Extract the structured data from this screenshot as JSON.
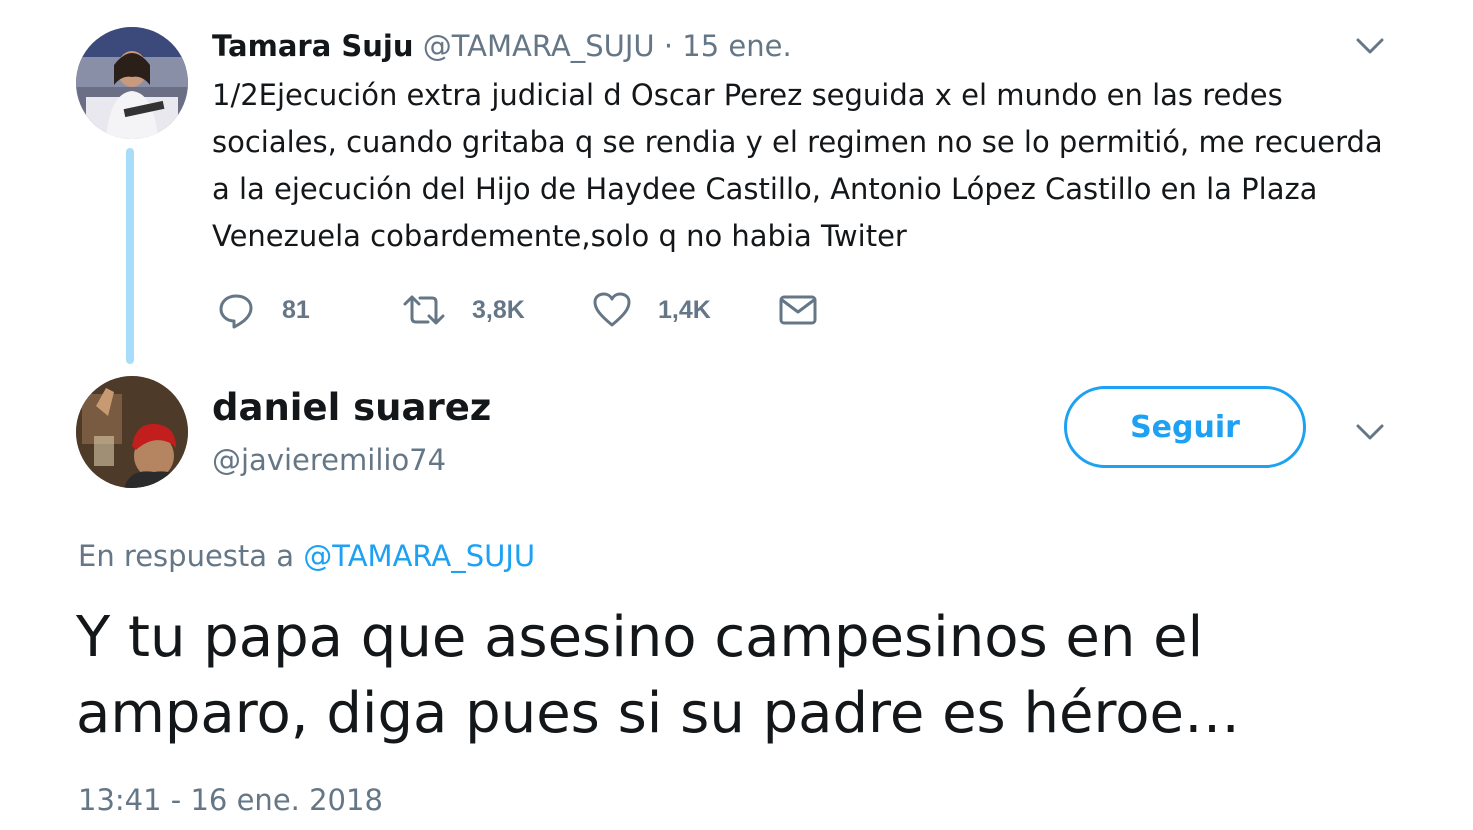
{
  "parent_tweet": {
    "avatar_icon": "profile-photo-woman-at-desk",
    "author_name": "Tamara Suju",
    "author_handle": "@TAMARA_SUJU",
    "separator": " · ",
    "date": "15 ene.",
    "text_lines": [
      "1/2Ejecución extra judicial d Oscar Perez seguida x el mundo en las redes",
      "sociales, cuando gritaba q se rendia y el regimen no se lo permitió, me recuerda",
      "a la ejecución del Hijo de Haydee Castillo, Antonio López Castillo en la Plaza",
      "Venezuela cobardemente,solo q no habia Twiter"
    ],
    "actions": {
      "reply_count": "81",
      "retweet_count": "3,8K",
      "like_count": "1,4K"
    },
    "menu_icon": "chevron-down-icon"
  },
  "reply_tweet": {
    "avatar_icon": "profile-photo-red-beret",
    "author_name": "daniel suarez",
    "author_handle": "@javieremilio74",
    "follow_label": "Seguir",
    "reply_context_prefix": "En respuesta a ",
    "reply_context_mention": "@TAMARA_SUJU",
    "text_lines": [
      "Y tu papa que asesino campesinos en el",
      "amparo, diga pues si su padre es héroe…"
    ],
    "timestamp": "13:41 - 16 ene. 2018",
    "menu_icon": "chevron-down-icon"
  },
  "colors": {
    "text": "#14171a",
    "muted": "#657786",
    "accent": "#1da1f2",
    "thread_line": "#a7ddf8"
  }
}
